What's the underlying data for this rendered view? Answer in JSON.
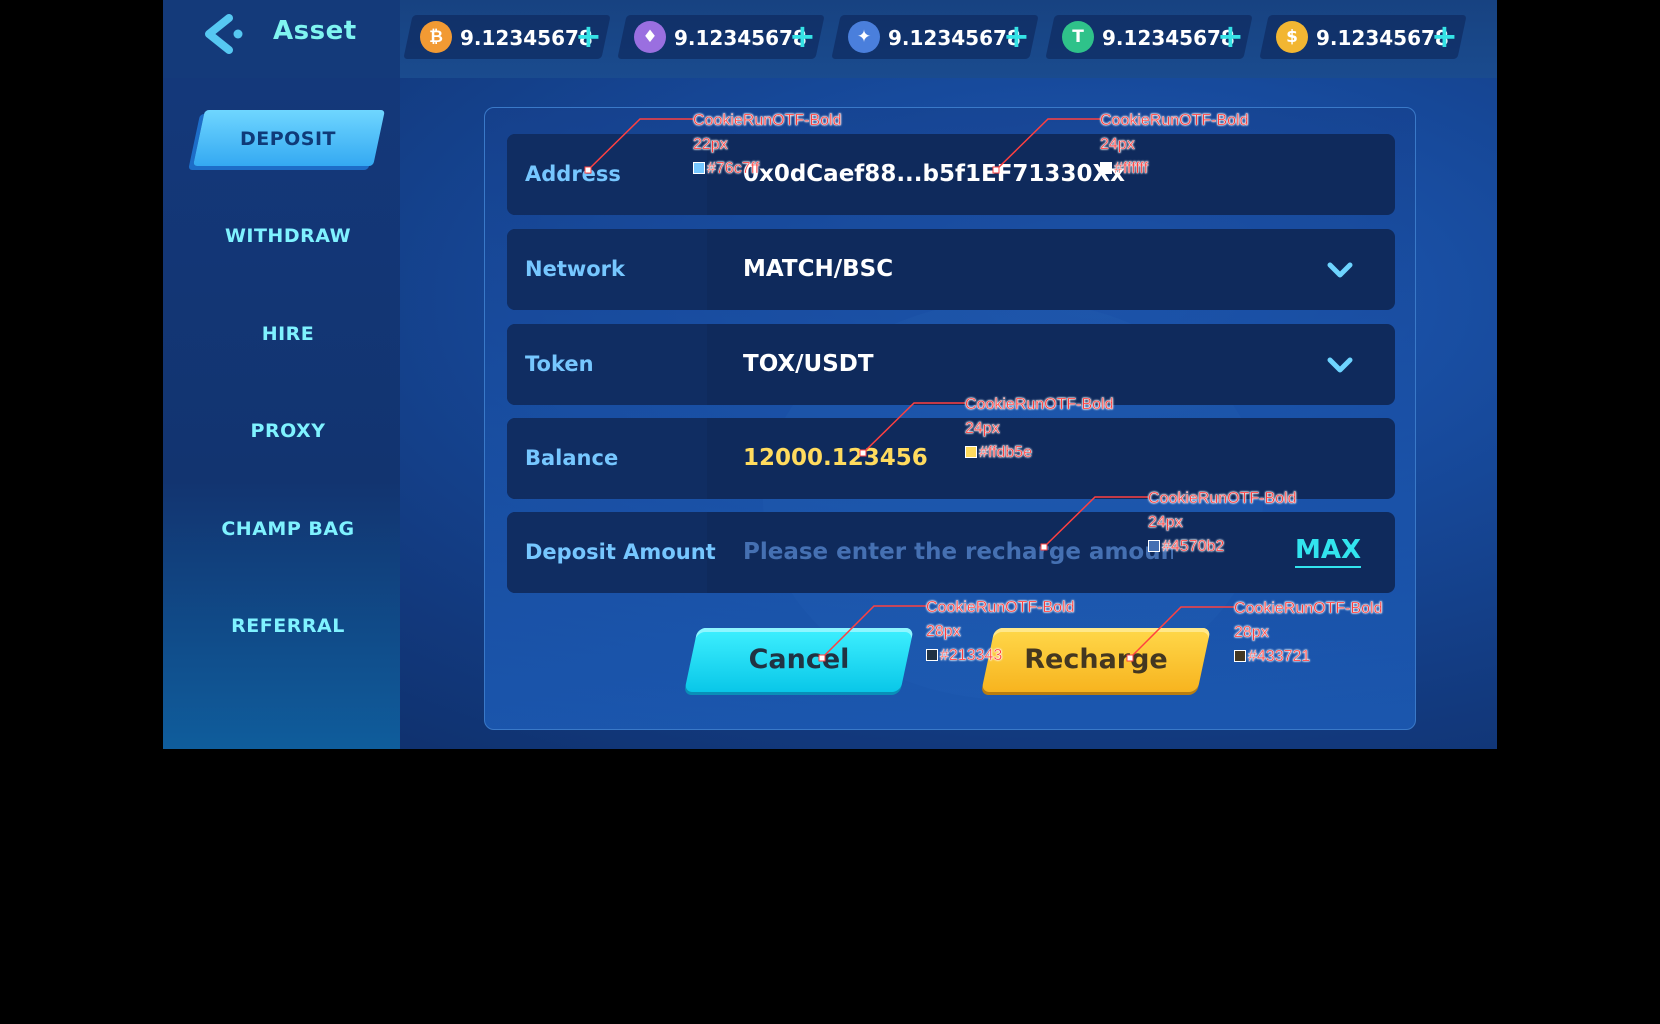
{
  "header": {
    "title": "Asset",
    "coins": [
      {
        "icon": "bitcoin-icon",
        "glyph": "₿",
        "color": "#f29a33",
        "value": "9.12345678"
      },
      {
        "icon": "ethereum-icon",
        "glyph": "♦",
        "color": "#9a6fe0",
        "value": "9.12345678"
      },
      {
        "icon": "flame-token-icon",
        "glyph": "✦",
        "color": "#4a7fdc",
        "value": "9.12345678"
      },
      {
        "icon": "tether-icon",
        "glyph": "T",
        "color": "#2fc28a",
        "value": "9.12345678"
      },
      {
        "icon": "dollar-coin-icon",
        "glyph": "$",
        "color": "#f2b632",
        "value": "9.12345678"
      }
    ],
    "plus_glyph": "+"
  },
  "sidebar": {
    "items": [
      {
        "label": "DEPOSIT",
        "active": true
      },
      {
        "label": "WITHDRAW",
        "active": false
      },
      {
        "label": "HIRE",
        "active": false
      },
      {
        "label": "PROXY",
        "active": false
      },
      {
        "label": "CHAMP BAG",
        "active": false
      },
      {
        "label": "REFERRAL",
        "active": false
      }
    ]
  },
  "form": {
    "address_label": "Address",
    "address_value": "0x0dCaef88...b5f1EF71330Xx",
    "network_label": "Network",
    "network_value": "MATCH/BSC",
    "token_label": "Token",
    "token_value": "TOX/USDT",
    "balance_label": "Balance",
    "balance_value": "12000.123456",
    "amount_label": "Deposit Amount",
    "amount_placeholder": "Please enter the recharge amount",
    "max_label": "MAX",
    "cancel_label": "Cancel",
    "recharge_label": "Recharge"
  },
  "colors": {
    "label": "#76c7ff",
    "value": "#ffffff",
    "balance": "#ffdb5e",
    "placeholder": "#4570b2",
    "cancel_text": "#213343",
    "recharge_text": "#433721",
    "accent": "#35e3e6"
  },
  "annotations": [
    {
      "font": "CookieRunOTF-Bold",
      "size": "22px",
      "color": "#76c7ff"
    },
    {
      "font": "CookieRunOTF-Bold",
      "size": "24px",
      "color": "#ffffff"
    },
    {
      "font": "CookieRunOTF-Bold",
      "size": "24px",
      "color": "#ffdb5e"
    },
    {
      "font": "CookieRunOTF-Bold",
      "size": "24px",
      "color": "#4570b2"
    },
    {
      "font": "CookieRunOTF-Bold",
      "size": "28px",
      "color": "#213343"
    },
    {
      "font": "CookieRunOTF-Bold",
      "size": "28px",
      "color": "#433721"
    }
  ]
}
